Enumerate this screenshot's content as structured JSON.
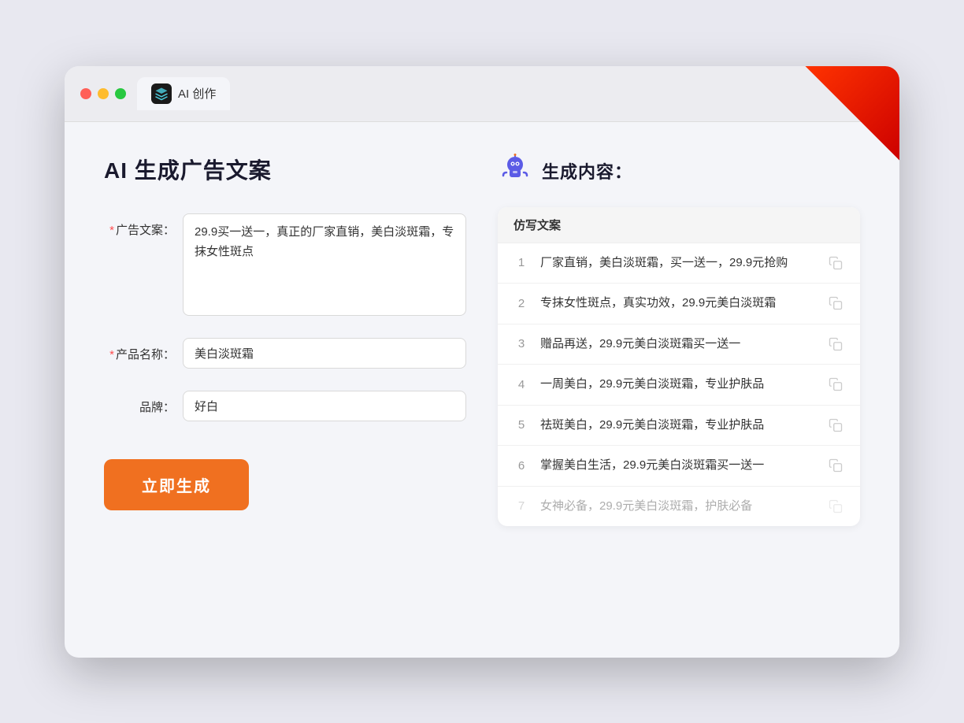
{
  "window": {
    "tab_label": "AI 创作"
  },
  "page": {
    "title": "AI 生成广告文案",
    "right_title": "生成内容："
  },
  "form": {
    "ad_copy_label": "广告文案：",
    "ad_copy_required": true,
    "ad_copy_value": "29.9买一送一，真正的厂家直销，美白淡斑霜，专抹女性斑点",
    "product_name_label": "产品名称：",
    "product_name_required": true,
    "product_name_value": "美白淡斑霜",
    "brand_label": "品牌：",
    "brand_required": false,
    "brand_value": "好白",
    "submit_label": "立即生成"
  },
  "results": {
    "table_header": "仿写文案",
    "rows": [
      {
        "num": "1",
        "text": "厂家直销，美白淡斑霜，买一送一，29.9元抢购",
        "faded": false
      },
      {
        "num": "2",
        "text": "专抹女性斑点，真实功效，29.9元美白淡斑霜",
        "faded": false
      },
      {
        "num": "3",
        "text": "赠品再送，29.9元美白淡斑霜买一送一",
        "faded": false
      },
      {
        "num": "4",
        "text": "一周美白，29.9元美白淡斑霜，专业护肤品",
        "faded": false
      },
      {
        "num": "5",
        "text": "祛斑美白，29.9元美白淡斑霜，专业护肤品",
        "faded": false
      },
      {
        "num": "6",
        "text": "掌握美白生活，29.9元美白淡斑霜买一送一",
        "faded": false
      },
      {
        "num": "7",
        "text": "女神必备，29.9元美白淡斑霜，护肤必备",
        "faded": true
      }
    ]
  }
}
